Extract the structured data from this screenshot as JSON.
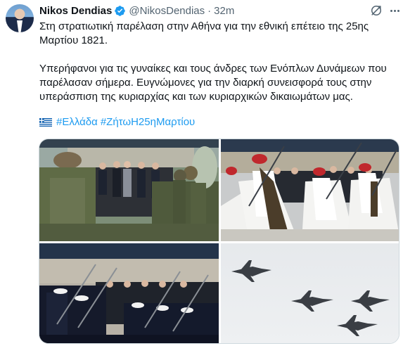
{
  "tweet": {
    "author": {
      "name": "Nikos Dendias",
      "handle": "@NikosDendias",
      "verified": true
    },
    "separator": "·",
    "time": "32m",
    "paragraphs": [
      "Στη στρατιωτική παρέλαση στην Αθήνα για την εθνική επέτειο της 25ης Μαρτίου 1821.",
      "Υπερήφανοι για τις γυναίκες και τους άνδρες των Ενόπλων Δυνάμεων που παρέλασαν σήμερα. Ευγνώμονες για την διαρκή συνεισφορά τους στην υπεράσπιση της κυριαρχίας και των κυριαρχικών δικαιωμάτων μας."
    ],
    "hashtags": [
      "#Ελλάδα",
      "#ΖήτωΗ25ηΜαρτίου"
    ],
    "flag_icon": "greek-flag-emoji",
    "colors": {
      "link": "#1d9bf0",
      "verified": "#1d9bf0",
      "secondary_text": "#536471"
    },
    "icons": [
      "grok-icon",
      "more-icon"
    ]
  }
}
